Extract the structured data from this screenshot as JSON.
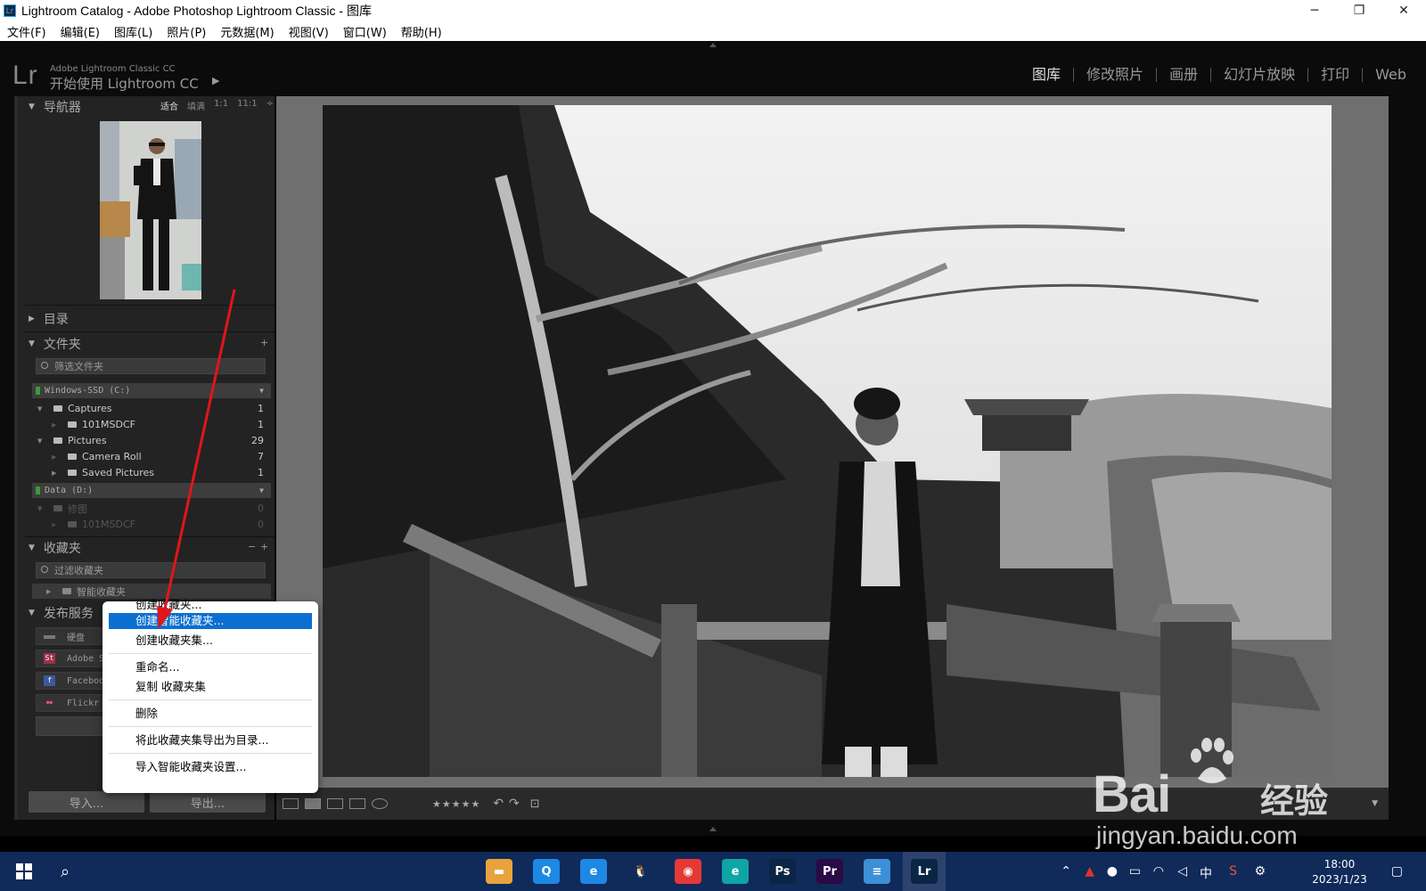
{
  "window": {
    "title": "Lightroom Catalog - Adobe Photoshop Lightroom Classic - 图库",
    "app_icon": "Lr",
    "minimize_icon": "─",
    "maximize_icon": "❐",
    "close_icon": "✕"
  },
  "menubar": [
    "文件(F)",
    "编辑(E)",
    "图库(L)",
    "照片(P)",
    "元数据(M)",
    "视图(V)",
    "窗口(W)",
    "帮助(H)"
  ],
  "header": {
    "logo": "Lr",
    "brand_line1": "Adobe Lightroom Classic CC",
    "brand_line2": "开始使用 Lightroom CC",
    "brand_arrow": "▶",
    "modules": [
      {
        "label": "图库",
        "active": true
      },
      {
        "label": "修改照片",
        "active": false
      },
      {
        "label": "画册",
        "active": false
      },
      {
        "label": "幻灯片放映",
        "active": false
      },
      {
        "label": "打印",
        "active": false
      },
      {
        "label": "Web",
        "active": false
      }
    ]
  },
  "navigator": {
    "title": "导航器",
    "zoom": [
      "适合",
      "填满",
      "1:1",
      "11:1",
      "÷"
    ]
  },
  "catalog": {
    "title": "目录"
  },
  "folders": {
    "title": "文件夹",
    "add": "+",
    "filter_placeholder": "筛选文件夹",
    "volumes": [
      {
        "name": "Windows-SSD (C:)",
        "rows": [
          {
            "label": "Captures",
            "count": "1",
            "level": 0,
            "expanded": true
          },
          {
            "label": "101MSDCF",
            "count": "1",
            "level": 1,
            "expanded": false
          },
          {
            "label": "Pictures",
            "count": "29",
            "level": 0,
            "expanded": true
          },
          {
            "label": "Camera Roll",
            "count": "7",
            "level": 1,
            "expanded": false
          },
          {
            "label": "Saved Pictures",
            "count": "1",
            "level": 1,
            "expanded": false
          }
        ]
      },
      {
        "name": "Data (D:)",
        "rows": [
          {
            "label": "修图",
            "count": "0",
            "level": 0,
            "expanded": true
          },
          {
            "label": "101MSDCF",
            "count": "0",
            "level": 1,
            "expanded": false
          }
        ]
      }
    ]
  },
  "collections": {
    "title": "收藏夹",
    "minus": "−",
    "plus": "+",
    "filter_placeholder": "过滤收藏夹",
    "items": [
      {
        "label": "智能收藏夹"
      }
    ]
  },
  "publish": {
    "title": "发布服务",
    "services": [
      {
        "label": "硬盘",
        "icon": "hard-drive-icon",
        "color": "#777777"
      },
      {
        "label": "Adobe St",
        "icon": "adobe-stock-icon",
        "color": "#a0304a",
        "glyph": "St"
      },
      {
        "label": "Facebook",
        "icon": "facebook-icon",
        "color": "#3b5998",
        "glyph": "f"
      },
      {
        "label": "Flickr",
        "icon": "flickr-icon",
        "color": "#333333",
        "glyph": "●●"
      }
    ]
  },
  "bottom_buttons": {
    "import": "导入...",
    "export": "导出..."
  },
  "context_menu": {
    "items": [
      {
        "label": "创建收藏夹...",
        "highlighted": false
      },
      {
        "label": "创建智能收藏夹...",
        "highlighted": true
      },
      {
        "label": "创建收藏夹集...",
        "highlighted": false
      },
      {
        "label": "重命名...",
        "highlighted": false
      },
      {
        "label": "复制 收藏夹集",
        "highlighted": false
      },
      {
        "label": "删除",
        "highlighted": false
      },
      {
        "label": "将此收藏夹集导出为目录...",
        "highlighted": false
      },
      {
        "label": "导入智能收藏夹设置...",
        "highlighted": false
      }
    ]
  },
  "toolbar": {
    "stars": "★★★★★",
    "rotate_left": "↶",
    "rotate_right": "↷",
    "crop": "⊡",
    "dropdown": "▼"
  },
  "watermark": {
    "brand": "Bai",
    "brand_cn": "经验",
    "url": "jingyan.baidu.com"
  },
  "taskbar": {
    "clock_time": "18:00",
    "clock_date": "2023/1/23",
    "ime": "中",
    "apps": [
      {
        "name": "file-explorer",
        "color": "#e8a33d",
        "glyph": "▬"
      },
      {
        "name": "qq-browser",
        "color": "#1e88e5",
        "glyph": "Q"
      },
      {
        "name": "edge-legacy",
        "color": "#1e88e5",
        "glyph": "e"
      },
      {
        "name": "qq",
        "color": "#102a5a",
        "glyph": "🐧"
      },
      {
        "name": "chrome",
        "color": "#e53935",
        "glyph": "◉"
      },
      {
        "name": "edge",
        "color": "#0ea5a4",
        "glyph": "e"
      },
      {
        "name": "photoshop",
        "color": "#0b2545",
        "glyph": "Ps"
      },
      {
        "name": "premiere",
        "color": "#2a0b45",
        "glyph": "Pr"
      },
      {
        "name": "notepad",
        "color": "#3d8fd6",
        "glyph": "≡"
      },
      {
        "name": "lightroom",
        "color": "#0b2545",
        "glyph": "Lr"
      }
    ]
  }
}
